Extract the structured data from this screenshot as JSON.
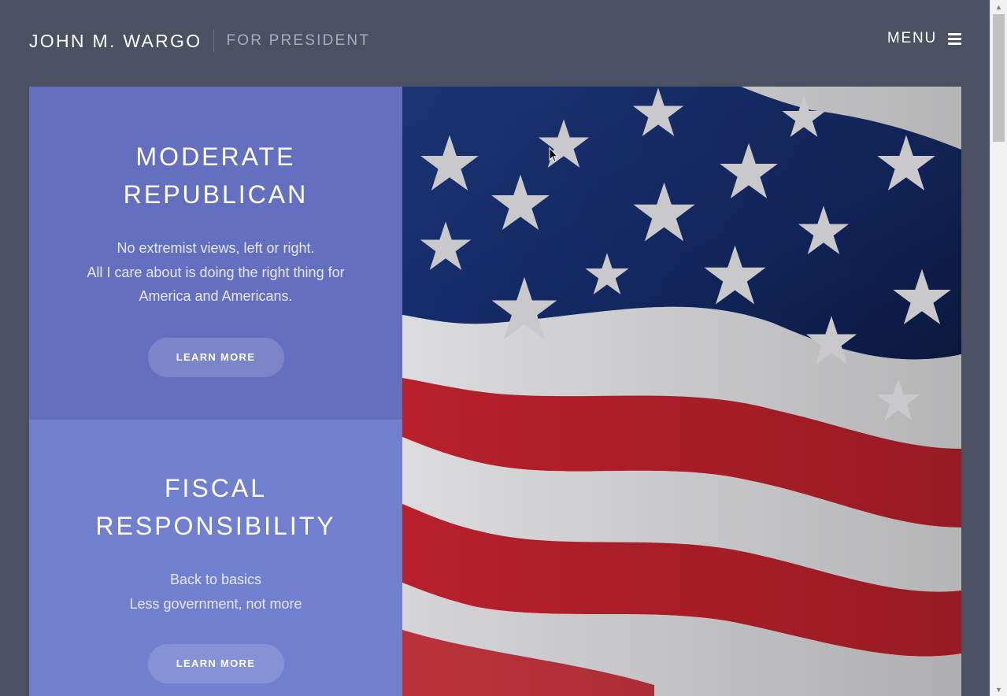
{
  "header": {
    "brand_name": "JOHN M. WARGO",
    "brand_tagline": "FOR PRESIDENT",
    "menu_label": "MENU",
    "menu_icon": "hamburger-icon"
  },
  "features": [
    {
      "title_line1": "MODERATE",
      "title_line2": "REPUBLICAN",
      "text_lines": [
        "No extremist views, left or right.",
        "All I care about is doing the right thing for",
        "America and Americans."
      ],
      "button_label": "LEARN MORE",
      "color": "#6470bf"
    },
    {
      "title_line1": "FISCAL",
      "title_line2": "RESPONSIBILITY",
      "text_lines": [
        "Back to basics",
        "Less government, not more"
      ],
      "button_label": "LEARN MORE",
      "color": "#7080cf"
    }
  ],
  "hero_image": {
    "subject": "american-flag",
    "colors": {
      "canton": "#142a66",
      "stripe_red": "#b8202b",
      "stripe_white": "#dcdcde",
      "star": "#c8c8ca"
    }
  },
  "page_background": "#4b5063"
}
